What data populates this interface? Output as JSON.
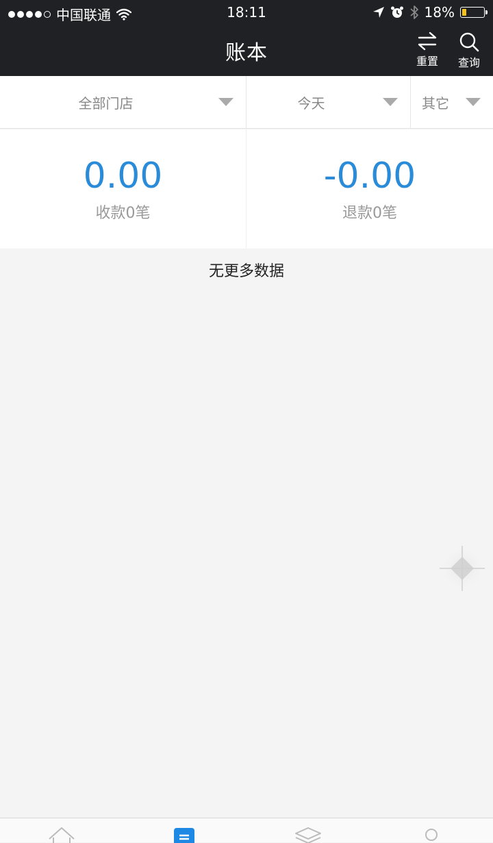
{
  "status_bar": {
    "carrier": "中国联通",
    "time": "18:11",
    "battery": "18%",
    "battery_level": 0.18
  },
  "header": {
    "title": "账本",
    "reset_label": "重置",
    "query_label": "查询"
  },
  "filters": {
    "store": "全部门店",
    "date": "今天",
    "other": "其它"
  },
  "summary": {
    "income_amount": "0.00",
    "income_count": "收款0笔",
    "refund_amount": "-0.00",
    "refund_count": "退款0笔"
  },
  "list": {
    "empty_message": "无更多数据"
  },
  "colors": {
    "header_bg": "#202124",
    "accent": "#2a8bd9",
    "page_bg": "#f4f4f4",
    "battery_fill": "#f4c21b"
  },
  "icons": {
    "reset": "swap-arrows-icon",
    "query": "search-icon",
    "tab_home": "home-icon",
    "tab_bills": "list-icon",
    "tab_layers": "layers-icon",
    "tab_profile": "user-icon"
  }
}
